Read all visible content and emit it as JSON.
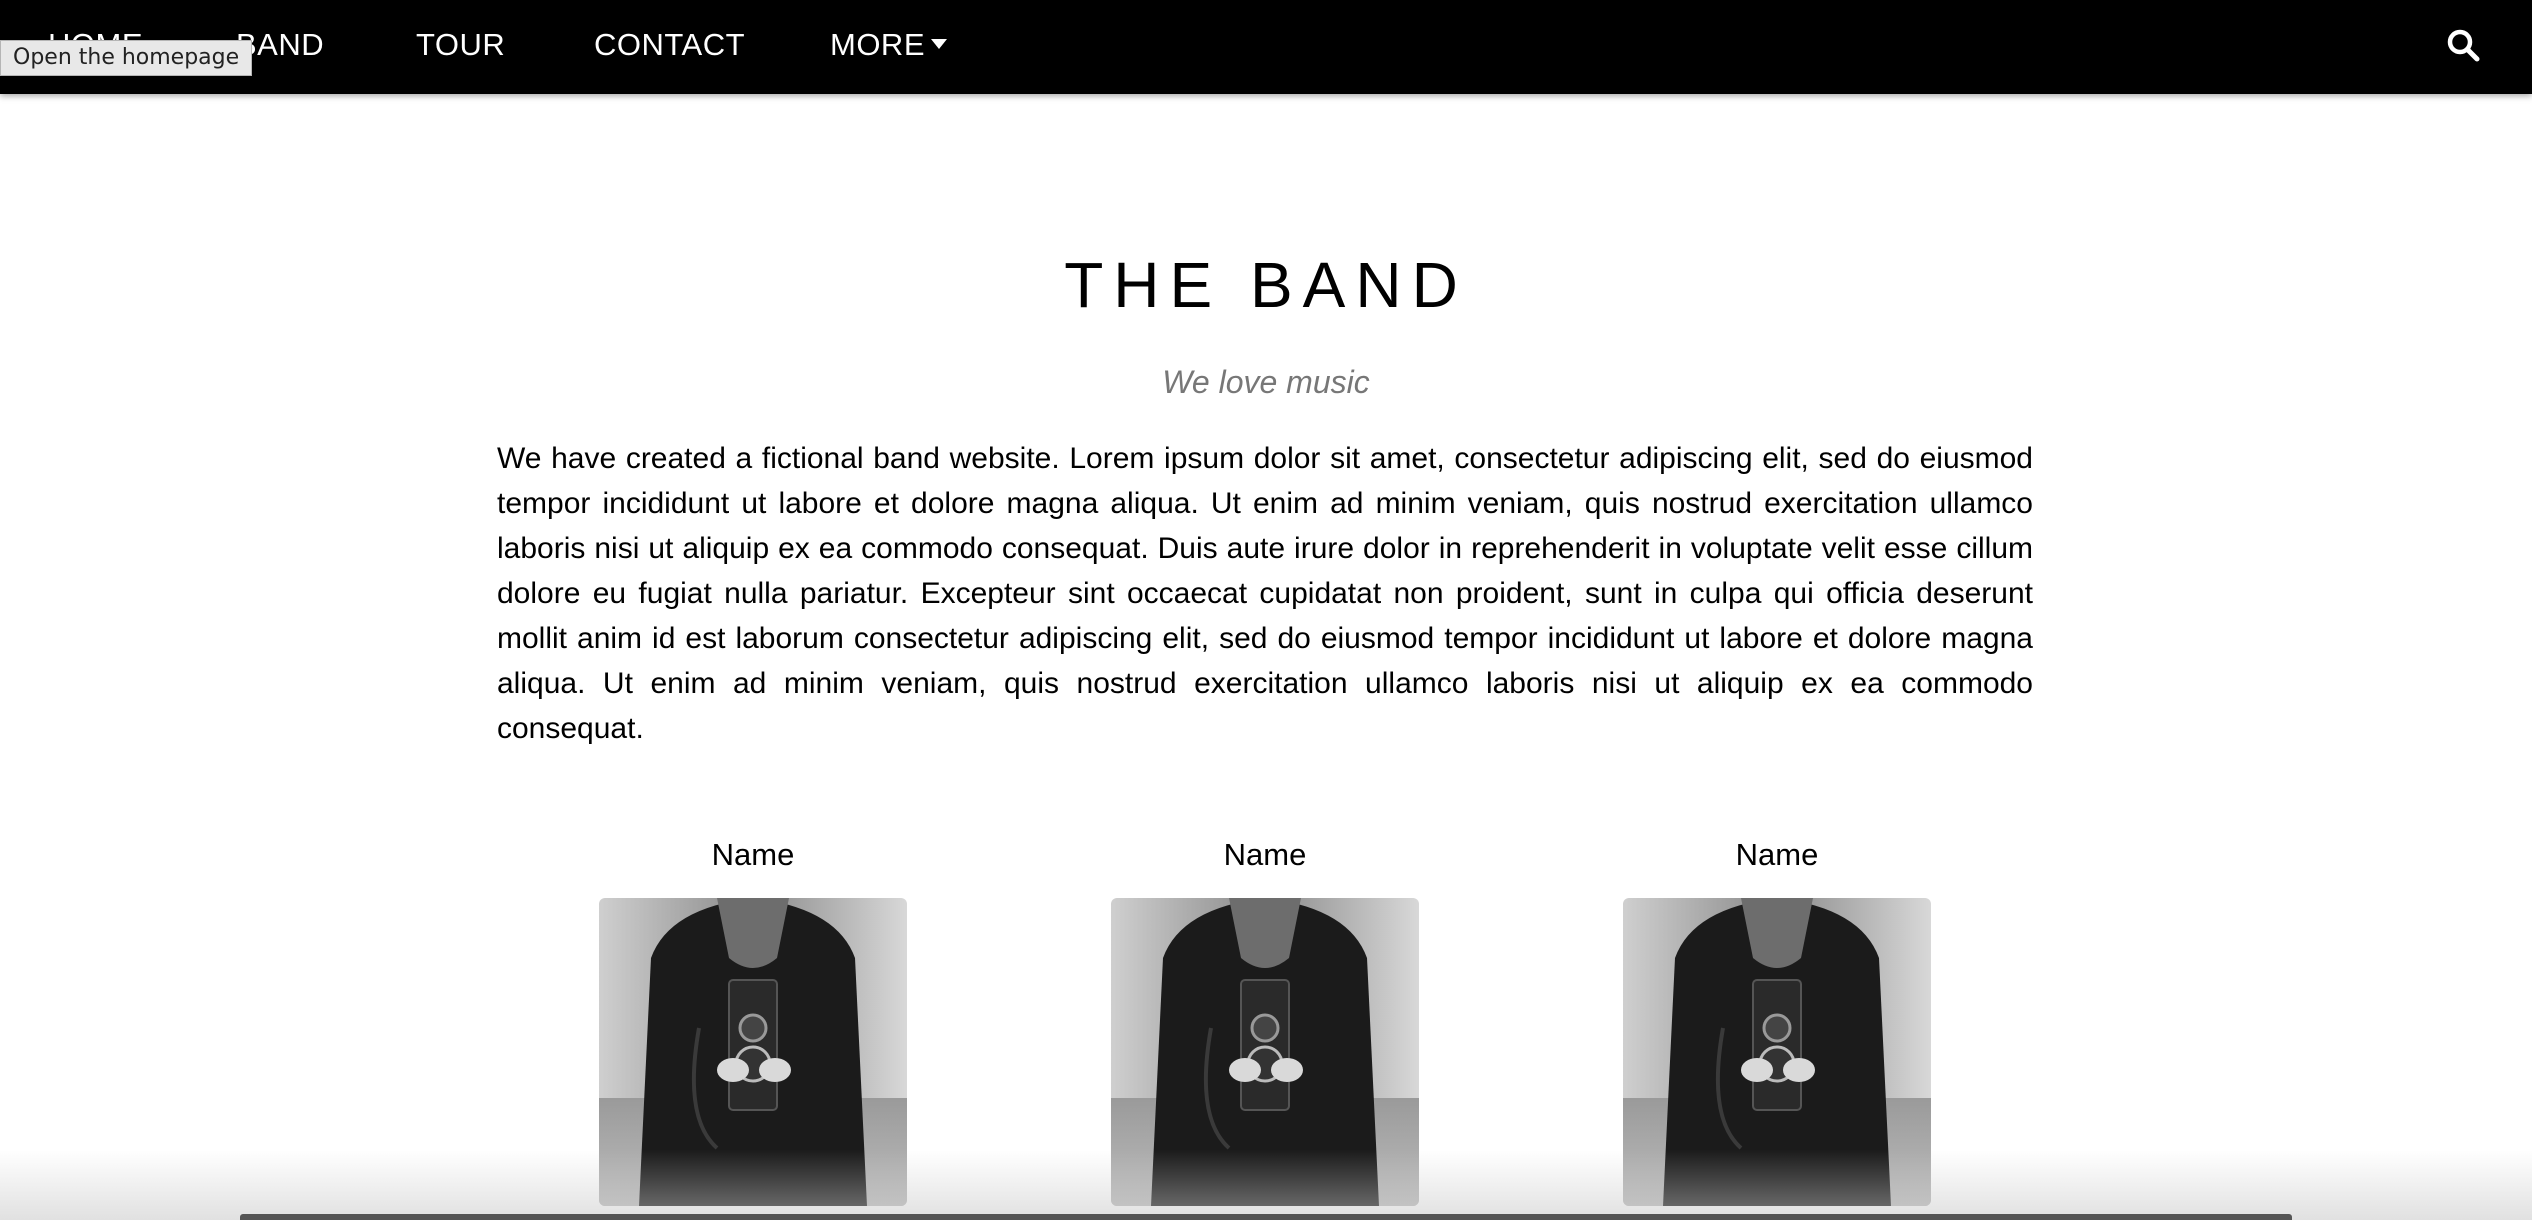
{
  "navbar": {
    "items": [
      {
        "label": "HOME"
      },
      {
        "label": "BAND"
      },
      {
        "label": "TOUR"
      },
      {
        "label": "CONTACT"
      },
      {
        "label": "MORE"
      }
    ],
    "search_icon": "search-icon",
    "more_icon": "caret-down-icon"
  },
  "tooltip": {
    "text": "Open the homepage"
  },
  "band": {
    "title": "THE BAND",
    "subtitle": "We love music",
    "text": "We have created a fictional band website. Lorem ipsum dolor sit amet, consectetur adipiscing elit, sed do eiusmod tempor incididunt ut labore et dolore magna aliqua. Ut enim ad minim veniam, quis nostrud exercitation ullamco laboris nisi ut aliquip ex ea commodo consequat. Duis aute irure dolor in reprehenderit in voluptate velit esse cillum dolore eu fugiat nulla pariatur. Excepteur sint occaecat cupidatat non proident, sunt in culpa qui officia deserunt mollit anim id est laborum consectetur adipiscing elit, sed do eiusmod tempor incididunt ut labore et dolore magna aliqua. Ut enim ad minim veniam, quis nostrud exercitation ullamco laboris nisi ut aliquip ex ea commodo consequat."
  },
  "members": [
    {
      "name": "Name"
    },
    {
      "name": "Name"
    },
    {
      "name": "Name"
    }
  ],
  "colors": {
    "navbar_bg": "#000000",
    "nav_text": "#ffffff",
    "subtitle": "#777777"
  }
}
